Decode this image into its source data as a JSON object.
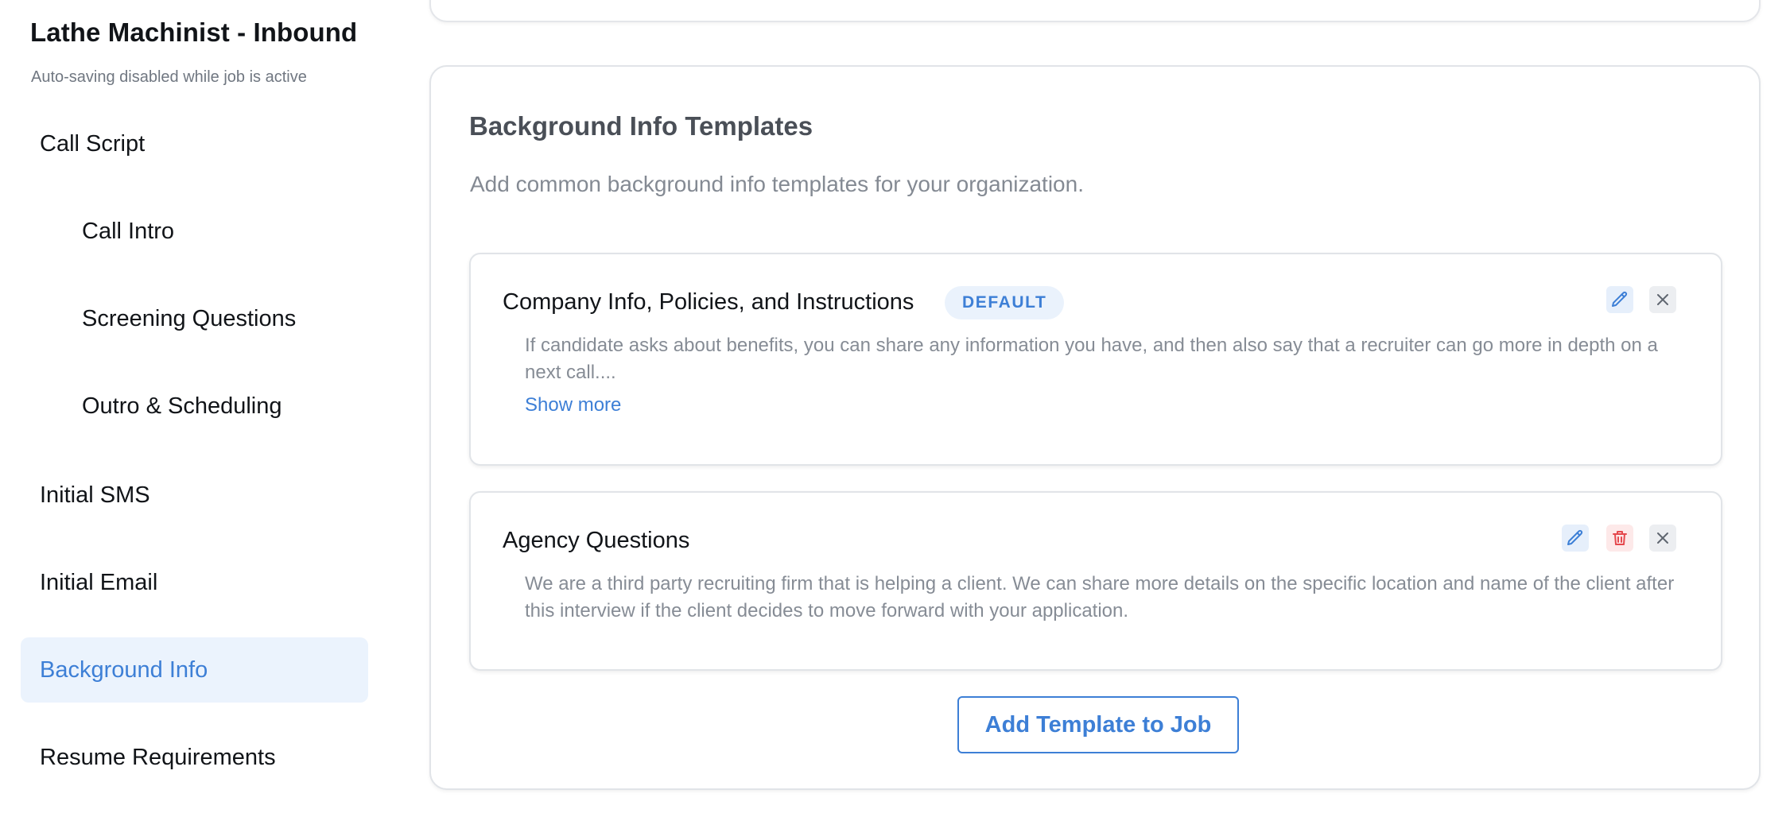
{
  "sidebar": {
    "job_title": "Lathe Machinist - Inbound",
    "subtitle": "Auto-saving disabled while job is active",
    "items": [
      {
        "label": "Call Script"
      },
      {
        "label": "Call Intro"
      },
      {
        "label": "Screening Questions"
      },
      {
        "label": "Outro & Scheduling"
      },
      {
        "label": "Initial SMS"
      },
      {
        "label": "Initial Email"
      },
      {
        "label": "Background Info"
      },
      {
        "label": "Resume Requirements"
      }
    ],
    "active_item": "Background Info"
  },
  "panel": {
    "title": "Background Info Templates",
    "description": "Add common background info templates for your organization.",
    "templates": [
      {
        "name": "Company Info, Policies, and Instructions",
        "badge": "DEFAULT",
        "body": "If candidate asks about benefits, you can share any information you have, and then also say that a recruiter can go more in depth on a next call....",
        "show_more": "Show more"
      },
      {
        "name": "Agency Questions",
        "body": "We are a third party recruiting firm that is helping a client. We can share more details on the specific location and name of the client after this interview if the client decides to move forward with your application."
      }
    ],
    "add_button": "Add Template to Job"
  },
  "icons": {
    "edit": "pencil-icon",
    "delete": "trash-icon",
    "remove": "close-icon"
  },
  "colors": {
    "accent": "#3d7fd6",
    "active_bg": "#ebf3fd",
    "danger": "#e5484d"
  }
}
